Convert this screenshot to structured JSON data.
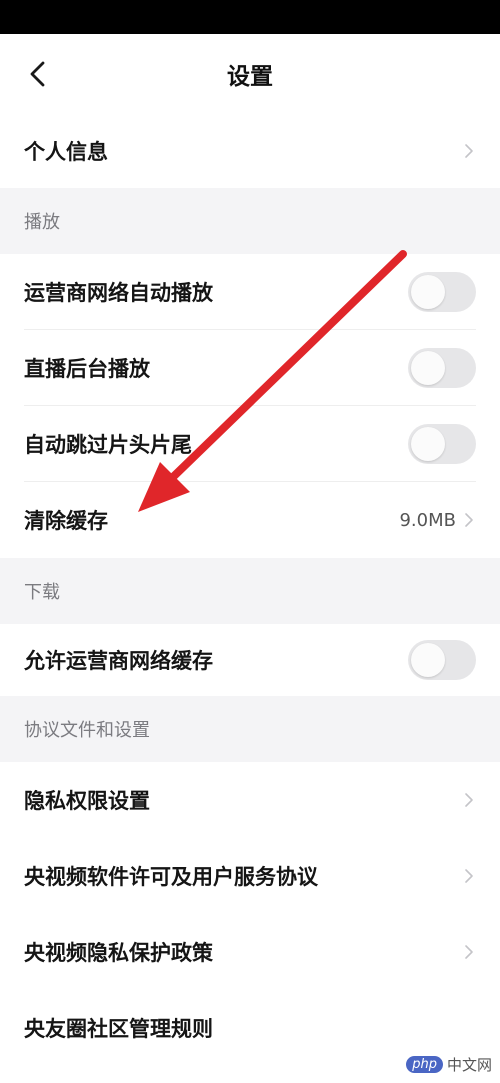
{
  "header": {
    "title": "设置",
    "back_icon": "chevron-left-icon"
  },
  "rows_top": [
    {
      "label": "个人信息",
      "type": "link"
    }
  ],
  "sections": {
    "playback": {
      "title": "播放",
      "items": [
        {
          "label": "运营商网络自动播放",
          "type": "toggle",
          "on": false
        },
        {
          "label": "直播后台播放",
          "type": "toggle",
          "on": false
        },
        {
          "label": "自动跳过片头片尾",
          "type": "toggle",
          "on": false
        },
        {
          "label": "清除缓存",
          "type": "link",
          "value": "9.0MB"
        }
      ]
    },
    "download": {
      "title": "下载",
      "items": [
        {
          "label": "允许运营商网络缓存",
          "type": "toggle",
          "on": false
        }
      ]
    },
    "agreements": {
      "title": "协议文件和设置",
      "items": [
        {
          "label": "隐私权限设置",
          "type": "link"
        },
        {
          "label": "央视频软件许可及用户服务协议",
          "type": "link"
        },
        {
          "label": "央视频隐私保护政策",
          "type": "link"
        },
        {
          "label": "央友圈社区管理规则",
          "type": "link"
        }
      ]
    }
  },
  "annotation": {
    "color": "#e0262a",
    "icon": "red-arrow-annotation"
  },
  "watermark": {
    "badge": "php",
    "text": "中文网"
  },
  "colors": {
    "section_bg": "#f4f4f6",
    "toggle_off": "#e6e6e8",
    "chevron": "#c4c4c8"
  }
}
